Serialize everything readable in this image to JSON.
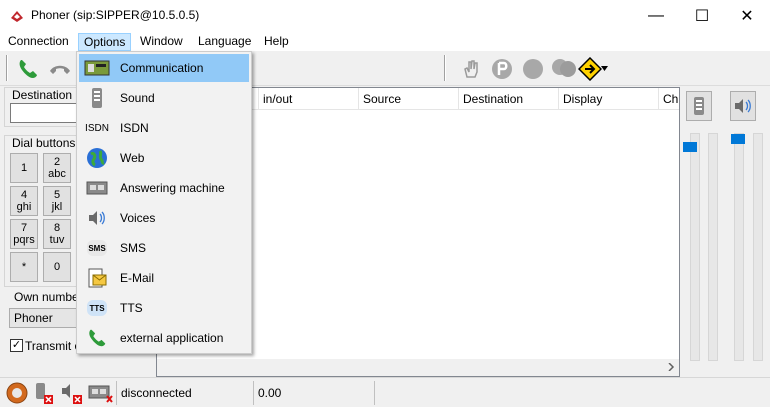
{
  "window": {
    "title": "Phoner (sip:SIPPER@10.5.0.5)",
    "controls": {
      "minimize": "—",
      "maximize": "☐",
      "close": "✕"
    }
  },
  "menubar": {
    "items": [
      {
        "label": "Connection"
      },
      {
        "label": "Options"
      },
      {
        "label": "Window"
      },
      {
        "label": "Language"
      },
      {
        "label": "Help"
      }
    ]
  },
  "options_menu": {
    "items": [
      {
        "label": "Communication",
        "icon": "communication-icon"
      },
      {
        "label": "Sound",
        "icon": "sound-icon"
      },
      {
        "label": "ISDN",
        "icon": "isdn-icon",
        "icon_text": "ISDN"
      },
      {
        "label": "Web",
        "icon": "globe-icon"
      },
      {
        "label": "Answering machine",
        "icon": "answering-machine-icon"
      },
      {
        "label": "Voices",
        "icon": "speaker-icon"
      },
      {
        "label": "SMS",
        "icon": "sms-icon",
        "icon_text": "SMS"
      },
      {
        "label": "E-Mail",
        "icon": "email-icon"
      },
      {
        "label": "TTS",
        "icon": "tts-icon",
        "icon_text": "TTS"
      },
      {
        "label": "external application",
        "icon": "phone-green-icon"
      }
    ]
  },
  "left_panel": {
    "destination_label": "Destination nu",
    "dial_buttons_label": "Dial buttons",
    "dial_buttons": [
      {
        "main": "1",
        "sub": ""
      },
      {
        "main": "2",
        "sub": "abc"
      },
      {
        "main": "4",
        "sub": "ghi"
      },
      {
        "main": "5",
        "sub": "jkl"
      },
      {
        "main": "7",
        "sub": "pqrs"
      },
      {
        "main": "8",
        "sub": "tuv"
      },
      {
        "main": "*",
        "sub": ""
      },
      {
        "main": "0",
        "sub": ""
      }
    ],
    "own_number_label": "Own number",
    "own_number_value": "Phoner",
    "transmit_label": "Transmit ow"
  },
  "grid": {
    "columns": [
      "in/out",
      "Source",
      "Destination",
      "Display",
      "Ch"
    ]
  },
  "statusbar": {
    "connection_status": "disconnected",
    "value": "0.00"
  },
  "colors": {
    "accent": "#0078d7",
    "menu_highlight": "#91c9f7"
  }
}
